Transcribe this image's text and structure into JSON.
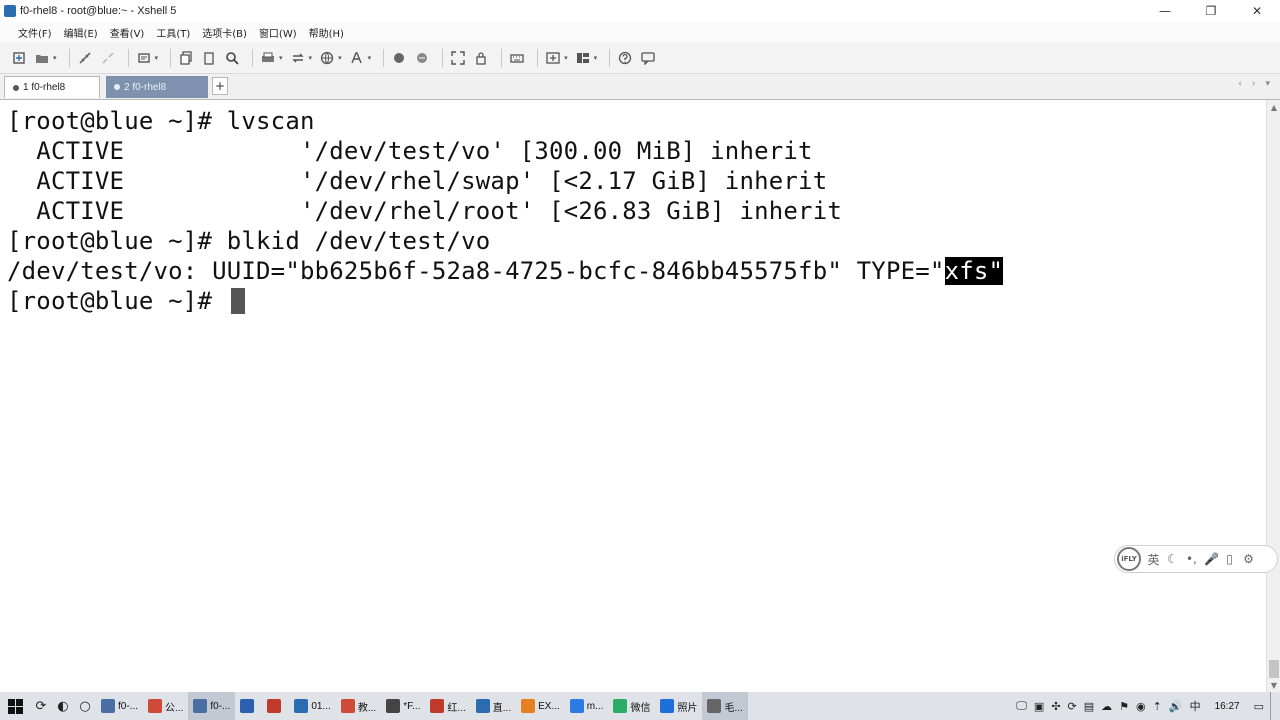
{
  "window": {
    "title": "f0-rhel8 - root@blue:~ - Xshell 5",
    "controls": [
      "—",
      "❐",
      "✕"
    ]
  },
  "menu": {
    "items": [
      "文件(F)",
      "编辑(E)",
      "查看(V)",
      "工具(T)",
      "选项卡(B)",
      "窗口(W)",
      "帮助(H)"
    ]
  },
  "toolbar": {
    "icons": [
      "new-session-icon",
      "open-folder-icon",
      "connect-icon",
      "disconnect-icon",
      "properties-icon",
      "copy-icon",
      "find-icon",
      "print-icon",
      "transfer-icon",
      "globe-icon",
      "font-icon",
      "xftp-icon",
      "xmanager-icon",
      "fullscreen-icon",
      "lock-icon",
      "keyboard-icon",
      "add-icon",
      "layout-icon",
      "help-icon",
      "chat-icon"
    ]
  },
  "tabs": [
    {
      "label": "1 f0-rhel8",
      "active": true
    },
    {
      "label": "2 f0-rhel8",
      "active": false
    }
  ],
  "tab_add_label": "+",
  "tab_nav": [
    "‹",
    "›",
    "▾"
  ],
  "terminal": {
    "lines": [
      {
        "text": "[root@blue ~]# lvscan"
      },
      {
        "text": "  ACTIVE            '/dev/test/vo' [300.00 MiB] inherit"
      },
      {
        "text": "  ACTIVE            '/dev/rhel/swap' [<2.17 GiB] inherit"
      },
      {
        "text": "  ACTIVE            '/dev/rhel/root' [<26.83 GiB] inherit"
      },
      {
        "text": "[root@blue ~]# blkid /dev/test/vo"
      },
      {
        "text": "/dev/test/vo: UUID=\"bb625b6f-52a8-4725-bcfc-846bb45575fb\" TYPE=\"",
        "highlight": "xfs\""
      },
      {
        "text": "[root@blue ~]# ",
        "cursor": true
      }
    ]
  },
  "ime": {
    "logo": "iFLY",
    "items": [
      "英",
      "☾",
      "•,",
      "🎤",
      "▯",
      "⚙"
    ]
  },
  "taskbar": {
    "apps": [
      {
        "label": "f0-...",
        "color": "#4a6fa5",
        "active": false
      },
      {
        "label": "公...",
        "color": "#d04a3a",
        "active": false
      },
      {
        "label": "f0-...",
        "color": "#4a6fa5",
        "active": true
      },
      {
        "label": "",
        "color": "#2b5fb0",
        "active": false
      },
      {
        "label": "",
        "color": "#c0392b",
        "active": false
      },
      {
        "label": "01...",
        "color": "#2b6cb0",
        "active": false
      },
      {
        "label": "教...",
        "color": "#d04a3a",
        "active": false
      },
      {
        "label": "*F...",
        "color": "#444444",
        "active": false
      },
      {
        "label": "红...",
        "color": "#c0392b",
        "active": false
      },
      {
        "label": "直...",
        "color": "#2b6cb0",
        "active": false
      },
      {
        "label": "EX...",
        "color": "#e67e22",
        "active": false
      },
      {
        "label": "m...",
        "color": "#2c7be5",
        "active": false
      },
      {
        "label": "微信",
        "color": "#2aae67",
        "active": false
      },
      {
        "label": "照片",
        "color": "#1e6fd9",
        "active": false
      },
      {
        "label": "毛...",
        "color": "#666666",
        "active": true
      }
    ],
    "tray": [
      "🖵",
      "▣",
      "✣",
      "⟳",
      "▤",
      "☁",
      "⚑",
      "◉",
      "⇡",
      "🔊",
      "中"
    ],
    "clock": "16:27"
  },
  "colors": {
    "tab_inactive_bg": "#7e92b0",
    "highlight_bg": "#000000",
    "taskbar_bg": "#dfe3e8"
  }
}
